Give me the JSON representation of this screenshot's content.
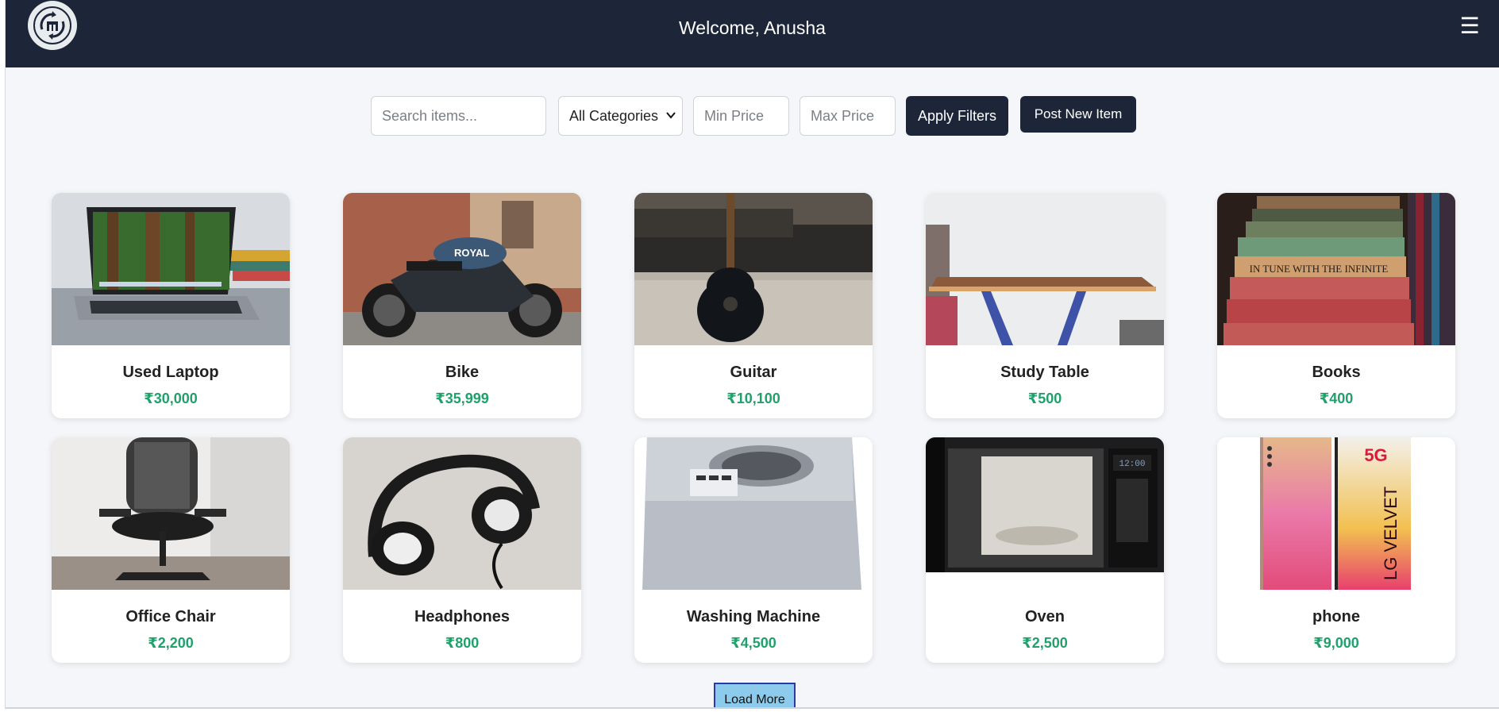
{
  "header": {
    "title": "Welcome, Anusha",
    "logo_icon": "recycle-shop-logo-icon",
    "menu_icon": "☰"
  },
  "filters": {
    "search_placeholder": "Search items...",
    "category_selected": "All Categories",
    "min_price_placeholder": "Min Price",
    "max_price_placeholder": "Max Price",
    "apply_label": "Apply Filters",
    "post_label": "Post New Item"
  },
  "items": [
    {
      "title": "Used Laptop",
      "price": "₹30,000"
    },
    {
      "title": "Bike",
      "price": "₹35,999"
    },
    {
      "title": "Guitar",
      "price": "₹10,100"
    },
    {
      "title": "Study Table",
      "price": "₹500"
    },
    {
      "title": "Books",
      "price": "₹400"
    },
    {
      "title": "Office Chair",
      "price": "₹2,200"
    },
    {
      "title": "Headphones",
      "price": "₹800"
    },
    {
      "title": "Washing Machine",
      "price": "₹4,500"
    },
    {
      "title": "Oven",
      "price": "₹2,500"
    },
    {
      "title": "phone",
      "price": "₹9,000"
    }
  ],
  "book_spine_text": "IN TUNE WITH THE INFINITE",
  "phone_brand_text": "LG VELVET",
  "phone_badge": "5G",
  "oven_clock": "12:00",
  "bike_tank_text": "ROYAL",
  "load_more_label": "Load More",
  "colors": {
    "navbar": "#1d2638",
    "price": "#22a06b",
    "load_more_bg": "#8ccbeb"
  }
}
